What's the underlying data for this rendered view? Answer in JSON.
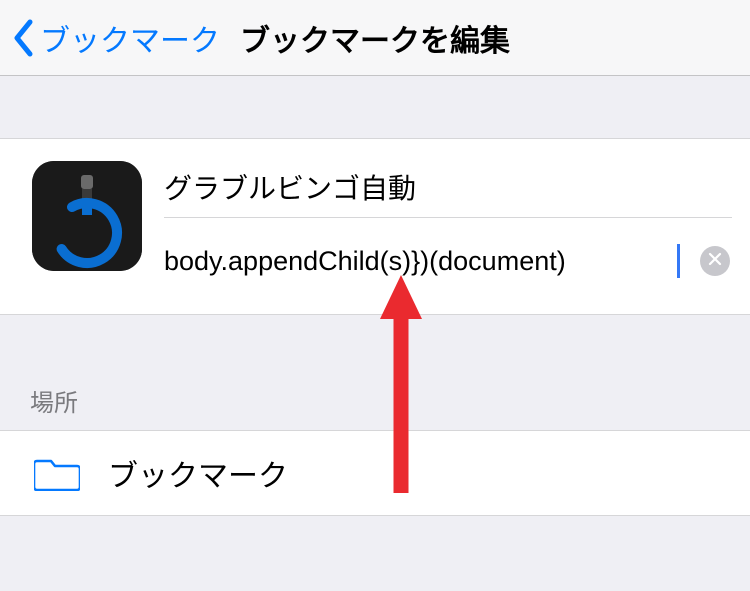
{
  "nav": {
    "back_label": "ブックマーク",
    "title": "ブックマークを編集"
  },
  "bookmark": {
    "name_value": "グラブルビンゴ自動",
    "url_value": "body.appendChild(s)})(document)"
  },
  "location": {
    "section_label": "場所",
    "folder_label": "ブックマーク"
  }
}
